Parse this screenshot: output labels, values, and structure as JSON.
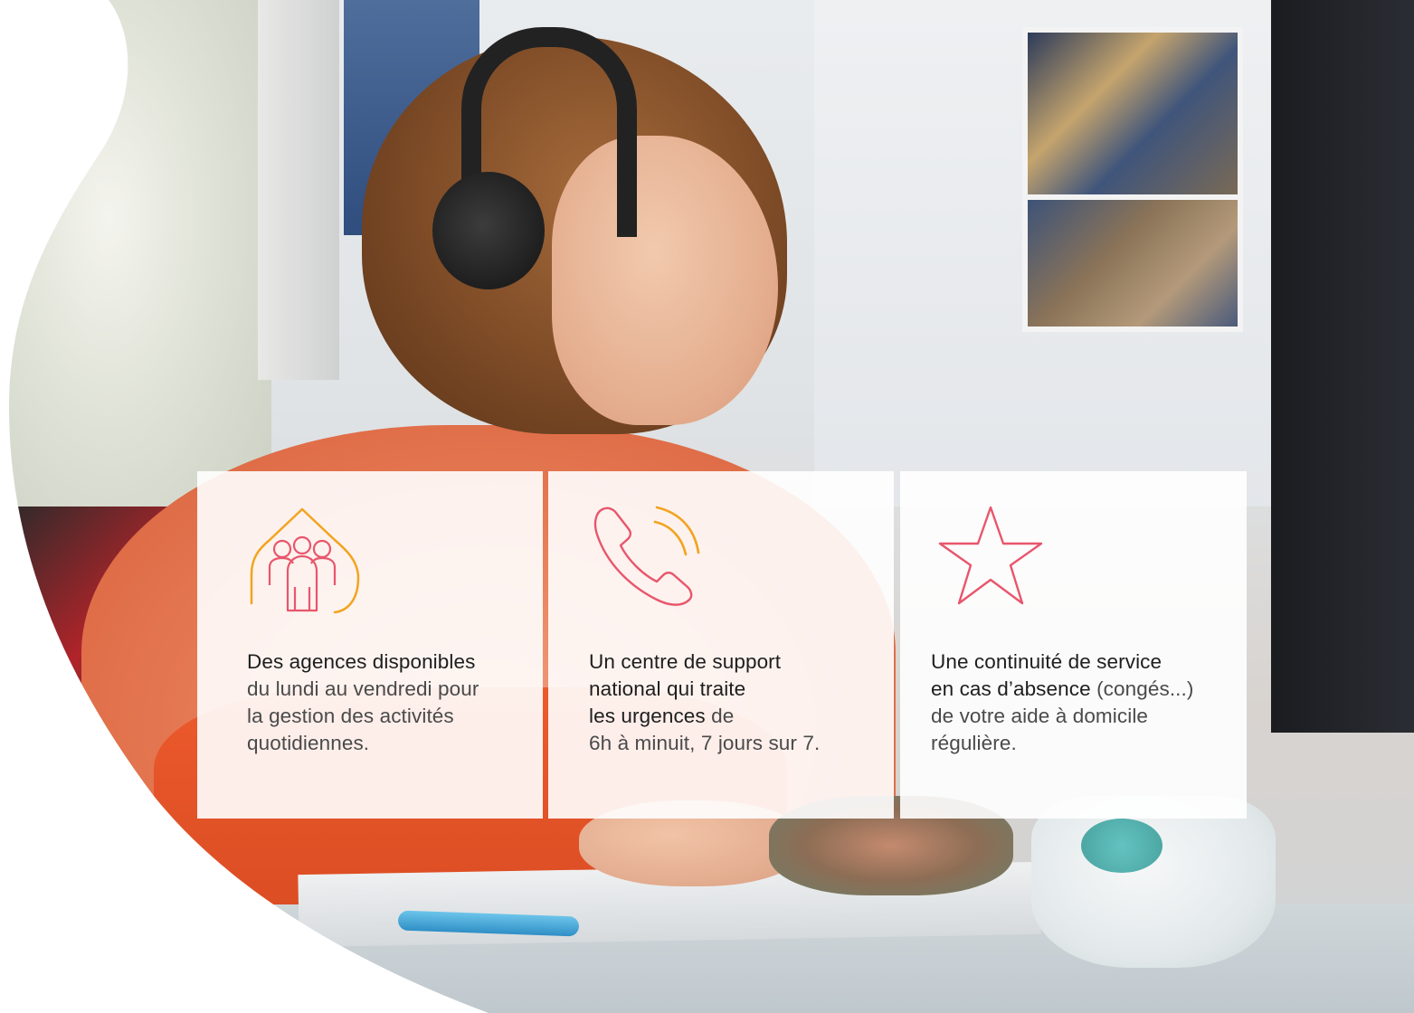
{
  "colors": {
    "accent_pink": "#e8566c",
    "accent_orange": "#f2a41f",
    "card_bg": "#ffffff",
    "text": "#333333"
  },
  "cards": [
    {
      "icon": "house-group-icon",
      "bold_text": "Des agences disponibles",
      "rest_lines": [
        "du lundi au vendredi pour",
        "la gestion des activités",
        "quotidiennes."
      ]
    },
    {
      "icon": "phone-ringing-icon",
      "bold_lines": [
        "Un centre de support",
        "national qui traite",
        "les urgences"
      ],
      "rest_inline": " de",
      "rest_lines": [
        "6h à minuit, 7 jours sur 7."
      ]
    },
    {
      "icon": "star-icon",
      "bold_lines": [
        "Une continuité de service",
        "en cas d’absence"
      ],
      "rest_inline": " (congés...)",
      "rest_lines": [
        "de votre aide à domicile",
        "régulière."
      ]
    }
  ]
}
